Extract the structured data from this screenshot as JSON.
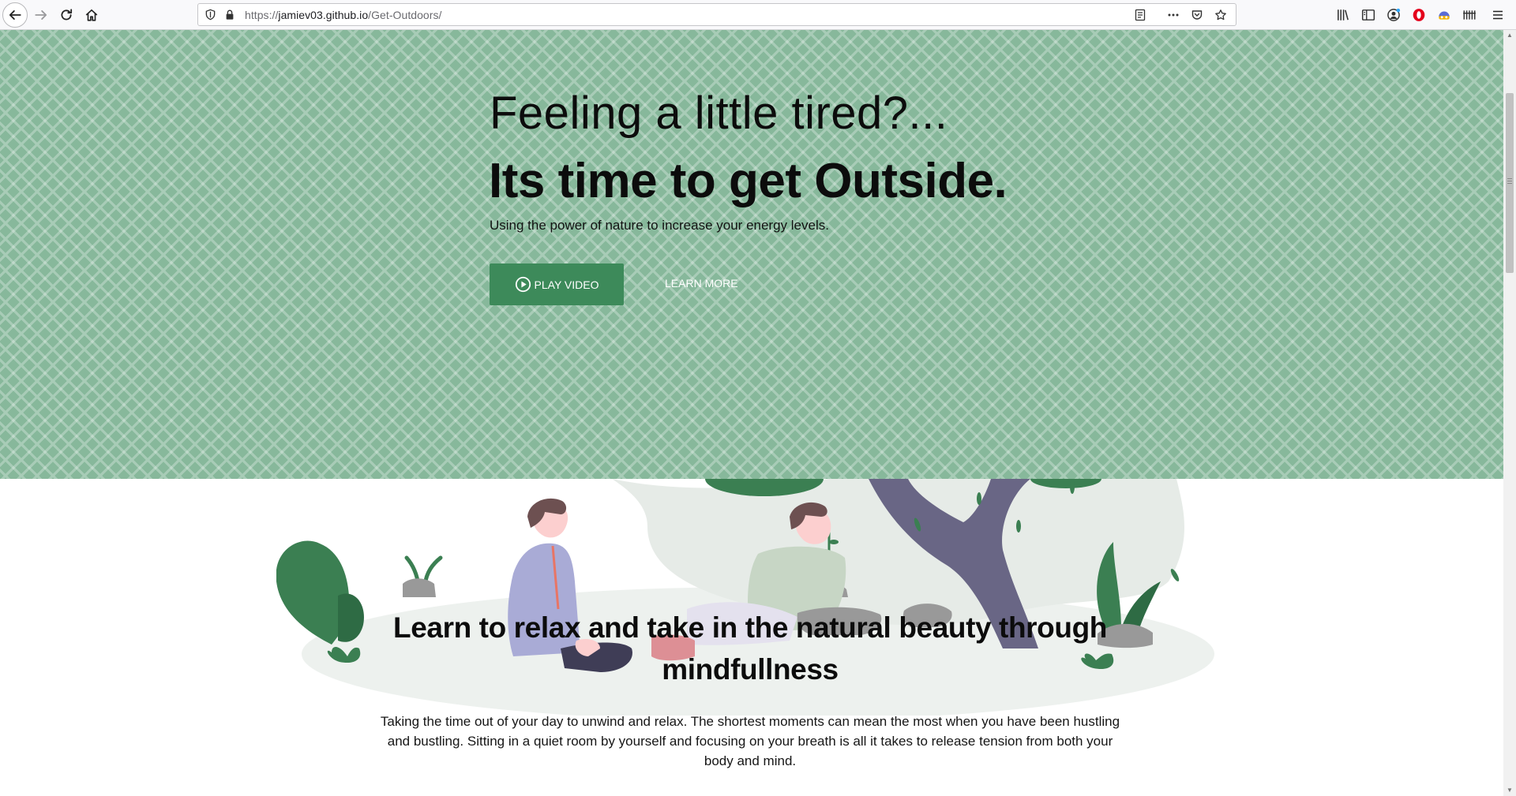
{
  "browser": {
    "url": {
      "prefix": "https://",
      "host": "jamiev03.github.io",
      "path": "/Get-Outdoors/"
    },
    "icons": {
      "back": "back-arrow-icon",
      "forward": "forward-arrow-icon",
      "reload": "reload-icon",
      "home": "home-icon",
      "shield": "tracking-protection-shield-icon",
      "lock": "lock-icon",
      "reader": "reader-view-icon",
      "more": "more-actions-icon",
      "pocket": "pocket-icon",
      "bookmark": "bookmark-star-icon",
      "library": "library-icon",
      "sidebar": "sidebar-icon",
      "account": "account-icon",
      "opera": "opera-extension-icon",
      "extension": "extension-icon",
      "grid": "grid-extension-icon",
      "menu": "hamburger-menu-icon"
    }
  },
  "hero": {
    "pre_title": "Feeling a little tired?...",
    "title": "Its time to get Outside.",
    "subtitle": "Using the power of nature to increase your energy levels.",
    "play_button": "PLAY VIDEO",
    "learn_button": "LEARN MORE",
    "bg_color": "#87b89b",
    "button_color": "#3d8a5a"
  },
  "mindfulness": {
    "title": "Learn to relax and take in the natural beauty through mindfullness",
    "body": "Taking the time out of your day to unwind and relax. The shortest moments can mean the most when you have been hustling and bustling. Sitting in a quiet room by yourself and focusing on your breath is all it takes to release tension from both your body and mind."
  }
}
